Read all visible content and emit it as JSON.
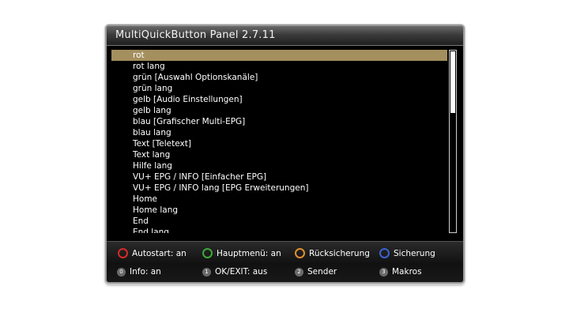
{
  "window": {
    "title": "MultiQuickButton Panel 2.7.11"
  },
  "list": {
    "items": [
      "rot",
      "rot lang",
      "grün [Auswahl Optionskanäle]",
      "grün lang",
      "gelb [Audio Einstellungen]",
      "gelb lang",
      "blau [Grafischer Multi-EPG]",
      "blau lang",
      "Text [Teletext]",
      "Text lang",
      "Hilfe lang",
      "VU+ EPG / INFO [Einfacher EPG]",
      "VU+ EPG / INFO lang [EPG Erweiterungen]",
      "Home",
      "Home lang",
      "End",
      "End lang"
    ],
    "selected_index": 0
  },
  "footer": {
    "color_buttons": [
      {
        "label": "Autostart: an",
        "color": "#d42a2a",
        "icon": "red-button-icon"
      },
      {
        "label": "Hauptmenü: an",
        "color": "#3aa83a",
        "icon": "green-button-icon"
      },
      {
        "label": "Rücksicherung",
        "color": "#e0902a",
        "icon": "yellow-button-icon"
      },
      {
        "label": "Sicherung",
        "color": "#3a62d0",
        "icon": "blue-button-icon"
      }
    ],
    "number_buttons": [
      {
        "num": "0",
        "label": "Info: an"
      },
      {
        "num": "1",
        "label": "OK/EXIT: aus"
      },
      {
        "num": "2",
        "label": "Sender"
      },
      {
        "num": "3",
        "label": "Makros"
      }
    ]
  },
  "colors": {
    "selection": "#a48f5e",
    "background": "#000000",
    "text": "#ffffff"
  }
}
